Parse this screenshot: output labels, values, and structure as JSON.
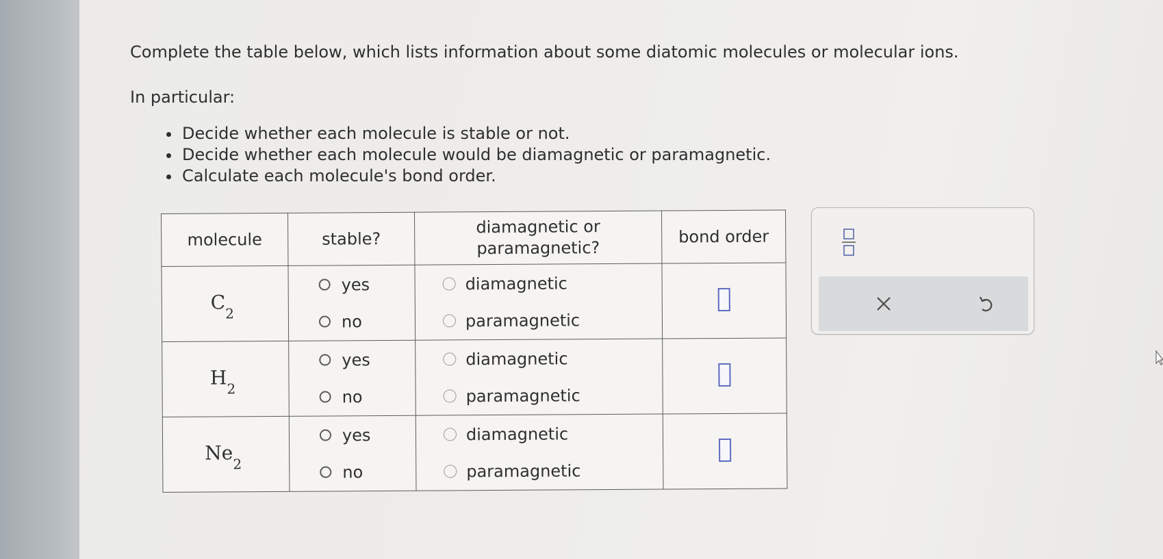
{
  "question": {
    "prompt": "Complete the table below, which lists information about some diatomic molecules or molecular ions.",
    "intro": "In particular:",
    "bullets": [
      "Decide whether each molecule is stable or not.",
      "Decide whether each molecule would be diamagnetic or paramagnetic.",
      "Calculate each molecule's bond order."
    ]
  },
  "table": {
    "headers": {
      "molecule": "molecule",
      "stable": "stable?",
      "magnetism_line1": "diamagnetic or",
      "magnetism_line2": "paramagnetic?",
      "bond_order": "bond order"
    },
    "rows": [
      {
        "symbol": "C",
        "subscript": "2",
        "stable_yes": "yes",
        "stable_no": "no",
        "mag_dia": "diamagnetic",
        "mag_para": "paramagnetic",
        "bond_order": ""
      },
      {
        "symbol": "H",
        "subscript": "2",
        "stable_yes": "yes",
        "stable_no": "no",
        "mag_dia": "diamagnetic",
        "mag_para": "paramagnetic",
        "bond_order": ""
      },
      {
        "symbol": "Ne",
        "subscript": "2",
        "stable_yes": "yes",
        "stable_no": "no",
        "mag_dia": "diamagnetic",
        "mag_para": "paramagnetic",
        "bond_order": ""
      }
    ]
  },
  "tools": {
    "fraction_icon": "fraction-icon",
    "clear_icon": "close-icon",
    "undo_icon": "undo-icon"
  },
  "colors": {
    "answer_box_border": "#5c6bc0",
    "text": "#2f2f2f",
    "tools_bar": "#d9dadb"
  }
}
